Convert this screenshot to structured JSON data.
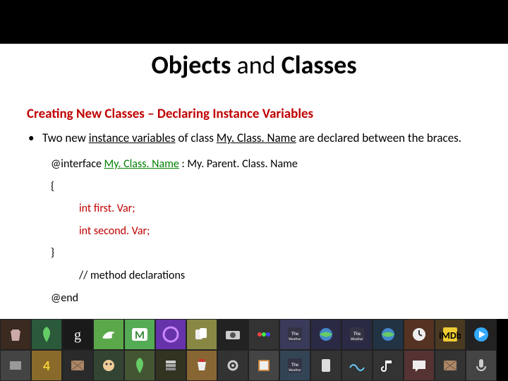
{
  "title": {
    "p1": "Objects",
    "p2": " and ",
    "p3": "Classes"
  },
  "subtitle": "Creating New Classes – Declaring Instance Variables",
  "bullet1": {
    "dot": "•",
    "pre": "Two new ",
    "iv": "instance variables",
    "mid": " of class ",
    "cls": "My. Class. Name",
    "post": " are declared between the braces."
  },
  "code": {
    "l1a": "@interface ",
    "l1b": "My. Class. Name",
    "l1c": " : My. Parent. Class. Name",
    "l2": "{",
    "l3": "int   first. Var;",
    "l4": "int   second. Var;",
    "l5": "}",
    "l6": "// method declarations",
    "l7": "@end"
  },
  "tiles": [
    {
      "bg": "#3a2a1f",
      "glyph": "trash"
    },
    {
      "bg": "#2a5a3a",
      "glyph": "leaf"
    },
    {
      "bg": "#1a1a1a",
      "glyph": "g"
    },
    {
      "bg": "#5aa84a",
      "glyph": "bird"
    },
    {
      "bg": "#55aa55",
      "glyph": "M"
    },
    {
      "bg": "#6633aa",
      "glyph": "swirl"
    },
    {
      "bg": "#888844",
      "glyph": "cards"
    },
    {
      "bg": "#222",
      "glyph": "cam"
    },
    {
      "bg": "#333",
      "glyph": "dots"
    },
    {
      "bg": "#3a3a5a",
      "glyph": "tw"
    },
    {
      "bg": "#2a2a44",
      "glyph": "globe"
    },
    {
      "bg": "#2a2a44",
      "glyph": "tw"
    },
    {
      "bg": "#223344",
      "glyph": "globe"
    },
    {
      "bg": "#553322",
      "glyph": "clock"
    },
    {
      "bg": "#4a3a22",
      "glyph": "i"
    },
    {
      "bg": "#222",
      "glyph": "play"
    },
    {
      "bg": "#444",
      "glyph": "box"
    },
    {
      "bg": "#8a6a2a",
      "glyph": "4"
    },
    {
      "bg": "#2a2a2a",
      "glyph": "crate"
    },
    {
      "bg": "#334433",
      "glyph": "face"
    },
    {
      "bg": "#445533",
      "glyph": "leaf"
    },
    {
      "bg": "#333322",
      "glyph": "stack"
    },
    {
      "bg": "#886633",
      "glyph": "cup"
    },
    {
      "bg": "#333",
      "glyph": "gear"
    },
    {
      "bg": "#444",
      "glyph": "book"
    },
    {
      "bg": "#334455",
      "glyph": "tw"
    },
    {
      "bg": "#333",
      "glyph": "pad"
    },
    {
      "bg": "#333",
      "glyph": "wave"
    },
    {
      "bg": "#333",
      "glyph": "note"
    },
    {
      "bg": "#553333",
      "glyph": "chat"
    },
    {
      "bg": "#333",
      "glyph": "crate"
    },
    {
      "bg": "#444",
      "glyph": "mic"
    }
  ]
}
